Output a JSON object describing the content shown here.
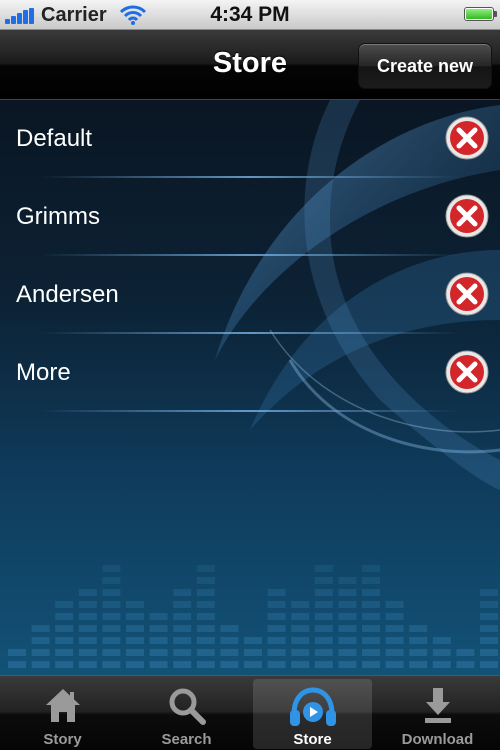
{
  "status_bar": {
    "carrier": "Carrier",
    "time": "4:34 PM"
  },
  "nav": {
    "title": "Store",
    "create_button": "Create new"
  },
  "stores": [
    {
      "label": "Default"
    },
    {
      "label": "Grimms"
    },
    {
      "label": "Andersen"
    },
    {
      "label": "More"
    }
  ],
  "tabs": [
    {
      "label": "Story",
      "icon": "home-icon",
      "active": false
    },
    {
      "label": "Search",
      "icon": "search-icon",
      "active": false
    },
    {
      "label": "Store",
      "icon": "headphones-icon",
      "active": true
    },
    {
      "label": "Download",
      "icon": "download-icon",
      "active": false
    }
  ],
  "colors": {
    "accent": "#1f8ee0",
    "delete": "#e02a2a",
    "background_bottom": "#125277"
  }
}
